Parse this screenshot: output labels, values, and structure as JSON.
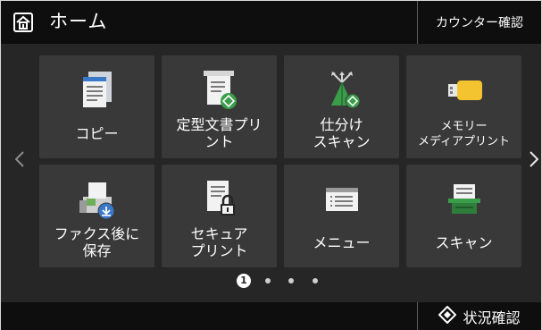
{
  "header": {
    "title": "ホーム",
    "counter_button": "カウンター確認"
  },
  "tiles": [
    {
      "label": "コピー",
      "icon": "copy-icon"
    },
    {
      "label": "定型文書プリ\nント",
      "icon": "template-print-icon"
    },
    {
      "label": "仕分け\nスキャン",
      "icon": "sort-scan-icon"
    },
    {
      "label": "メモリー\nメディアプリント",
      "icon": "memory-media-icon"
    },
    {
      "label": "ファクス後に\n保存",
      "icon": "fax-save-icon"
    },
    {
      "label": "セキュア\nプリント",
      "icon": "secure-print-icon"
    },
    {
      "label": "メニュー",
      "icon": "menu-icon"
    },
    {
      "label": "スキャン",
      "icon": "scan-icon"
    }
  ],
  "pagination": {
    "current_page": "1",
    "total_pages": 4
  },
  "footer": {
    "status_button": "状況確認"
  },
  "colors": {
    "background": "#262626",
    "bar": "#0e0e0e",
    "tile": "#393939",
    "accent_green": "#3a9d4a",
    "accent_yellow": "#f4c430"
  }
}
